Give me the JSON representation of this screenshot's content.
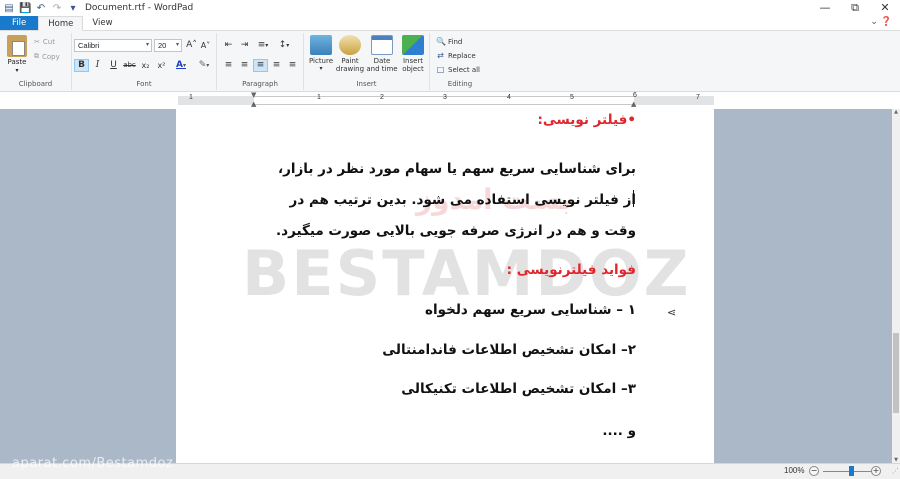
{
  "window": {
    "title": "Document.rtf - WordPad",
    "min_glyph": "—",
    "max_glyph": "⧉",
    "close_glyph": "✕"
  },
  "quick_access": [
    "save-icon",
    "undo-icon",
    "redo-icon",
    "customize-icon"
  ],
  "tabs": {
    "file": "File",
    "home": "Home",
    "view": "View"
  },
  "ribbon": {
    "clipboard": {
      "label": "Clipboard",
      "paste": "Paste",
      "cut": "Cut",
      "copy": "Copy"
    },
    "font": {
      "label": "Font",
      "name": "Calibri",
      "size": "20",
      "bold": "B",
      "italic": "I",
      "underline": "U",
      "strike": "abc",
      "sub": "x₂",
      "sup": "x²"
    },
    "paragraph": {
      "label": "Paragraph"
    },
    "insert": {
      "label": "Insert",
      "picture": "Picture",
      "paint": "Paint drawing",
      "datetime": "Date and time",
      "object": "Insert object"
    },
    "editing": {
      "label": "Editing",
      "find": "Find",
      "replace": "Replace",
      "select_all": "Select all"
    }
  },
  "ruler": {
    "numbers": [
      "1",
      "1",
      "2",
      "3",
      "4",
      "5",
      "6",
      "7"
    ]
  },
  "document": {
    "lines": [
      {
        "text": "•فیلتر نویسی:",
        "color": "#e0262c"
      },
      {
        "text": "برای شناسایی سریع سهم یا سهام مورد نظر در بازار،",
        "color": "#111111"
      },
      {
        "text": "از فیلتر نویسی استفاده می شود. بدین ترتیب هم در",
        "color": "#111111"
      },
      {
        "text": "وقت و هم در انرژی صرفه جویی بالایی صورت میگیرد.",
        "color": "#111111"
      },
      {
        "text": "فواید فیلترنویسی :",
        "color": "#e0262c"
      },
      {
        "text": "۱ – شناسایی سریع سهم دلخواه",
        "color": "#111111"
      },
      {
        "text": "۲– امکان تشخیص اطلاعات فاندامنتالی",
        "color": "#111111"
      },
      {
        "text": "۳– امکان تشخیص اطلاعات تکنیکالی",
        "color": "#111111"
      },
      {
        "text": "و ....",
        "color": "#111111"
      }
    ],
    "watermark_text": "BESTAMDOZ",
    "watermark_fa": "بست امدوز"
  },
  "status": {
    "zoom": "100%",
    "minus": "−",
    "plus": "+"
  },
  "overlay": {
    "aparat": "aparat.com/Bestamdoz"
  }
}
